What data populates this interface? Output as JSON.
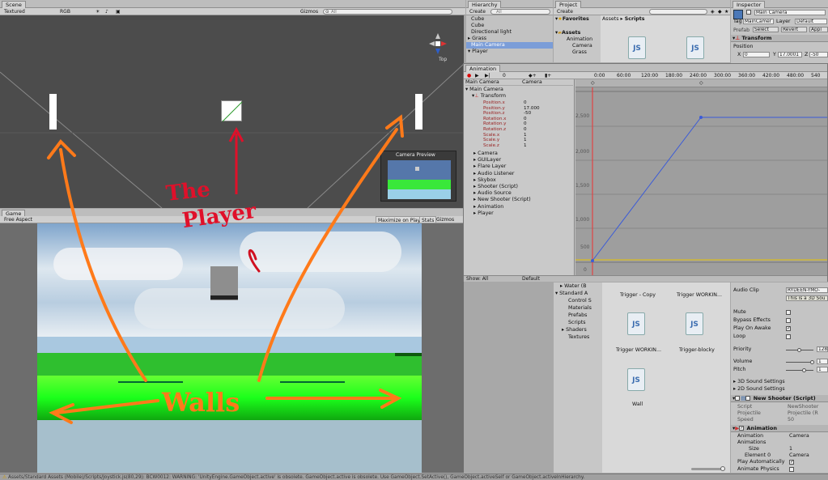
{
  "scene": {
    "tab": "Scene",
    "shading": "Textured",
    "render_mode": "RGB",
    "gizmos": "Gizmos",
    "search": "All",
    "gizmo_label": "Top",
    "preview_title": "Camera Preview"
  },
  "game": {
    "tab": "Game",
    "aspect": "Free Aspect",
    "maximize": "Maximize on Play",
    "stats": "Stats",
    "gizmos": "Gizmos"
  },
  "annotations": {
    "player_line1": "The",
    "player_line2": "Player",
    "walls": "Walls"
  },
  "hierarchy": {
    "tab": "Hierarchy",
    "create": "Create",
    "search": "All",
    "items": [
      "Cube",
      "Cube",
      "Directional light",
      "Grass",
      "Main Camera",
      "Player"
    ]
  },
  "project": {
    "tab": "Project",
    "create": "Create",
    "favorites": "Favorites",
    "assets": "Assets",
    "breadcrumb_root": "Assets",
    "breadcrumb_sep": "▸",
    "breadcrumb_leaf": "Scripts",
    "tree_top": [
      "Animation",
      "Camera",
      "Grass"
    ],
    "tree_bottom": [
      "Water (B",
      "Standard A",
      "Control S",
      "Materials",
      "Prefabs",
      "Scripts",
      "Shaders",
      "Textures"
    ],
    "files": [
      "Trigger - Copy",
      "Trigger WORKIN...",
      "Trigger WORKIN...",
      "Trigger-blocky",
      "Wall"
    ]
  },
  "animation": {
    "tab": "Animation",
    "object": "Main Camera",
    "clip": "Camera",
    "frame": "0",
    "root": "Main Camera",
    "transform": "Transform",
    "properties": [
      {
        "name": "Position.x",
        "value": "0"
      },
      {
        "name": "Position.y",
        "value": "17.000"
      },
      {
        "name": "Position.z",
        "value": "-50"
      },
      {
        "name": "Rotation.x",
        "value": "0"
      },
      {
        "name": "Rotation.y",
        "value": "0"
      },
      {
        "name": "Rotation.z",
        "value": "0"
      },
      {
        "name": "Scale.x",
        "value": "1"
      },
      {
        "name": "Scale.y",
        "value": "1"
      },
      {
        "name": "Scale.z",
        "value": "1"
      }
    ],
    "components": [
      "Camera",
      "GUILayer",
      "Flare Layer",
      "Audio Listener",
      "Skybox",
      "Shooter (Script)",
      "Audio Source",
      "New Shooter (Script)",
      "Animation",
      "Player"
    ],
    "show": "Show: All",
    "mode": "Default",
    "ruler": [
      "0:00",
      "60:00",
      "120:00",
      "180:00",
      "240:00",
      "300:00",
      "360:00",
      "420:00",
      "480:00",
      "540"
    ],
    "yticks": [
      "2,500",
      "2,000",
      "1,500",
      "1,000",
      "500",
      "0"
    ]
  },
  "inspector": {
    "tab": "Inspector",
    "object": "Main Camera",
    "tag_label": "Tag",
    "tag": "MainCamer",
    "layer_label": "Layer",
    "layer": "Default",
    "prefab": "Prefab",
    "select": "Select",
    "revert": "Revert",
    "apply": "Appl",
    "transform": "Transform",
    "position": "Position",
    "pos": {
      "x": "0",
      "y": "17.0001",
      "z": "-50"
    },
    "audio_clip_label": "Audio Clip",
    "audio_clip": "RYDEEN-YMO-",
    "note": "This is a 3D Sou",
    "mute": "Mute",
    "bypass": "Bypass Effects",
    "play_on_awake": "Play On Awake",
    "loop": "Loop",
    "priority": "Priority",
    "priority_val": "128",
    "volume": "Volume",
    "volume_val": "1",
    "pitch": "Pitch",
    "pitch_val": "1",
    "sound3d": "3D Sound Settings",
    "sound2d": "2D Sound Settings",
    "new_shooter": "New Shooter (Script)",
    "script_label": "Script",
    "script_val": "NewShooter",
    "projectile_label": "Projectile",
    "projectile_val": "Projectile (R",
    "speed_label": "Speed",
    "speed_val": "50",
    "animation": "Animation",
    "anim_label": "Animation",
    "anim_val": "Camera",
    "animations": "Animations",
    "size_label": "Size",
    "size_val": "1",
    "element0": "Element 0",
    "element0_val": "Camera",
    "play_auto": "Play Automatically",
    "animate_physics": "Animate Physics"
  },
  "status": "Assets/Standard Assets (Mobile)/Scripts/Joystick.js(80,29): BCW0012: WARNING: 'UnityEngine.GameObject.active' is obsolete. GameObject.active is obsolete. Use GameObject.SetActive(), GameObject.activeSelf or GameObject.activeInHierarchy."
}
